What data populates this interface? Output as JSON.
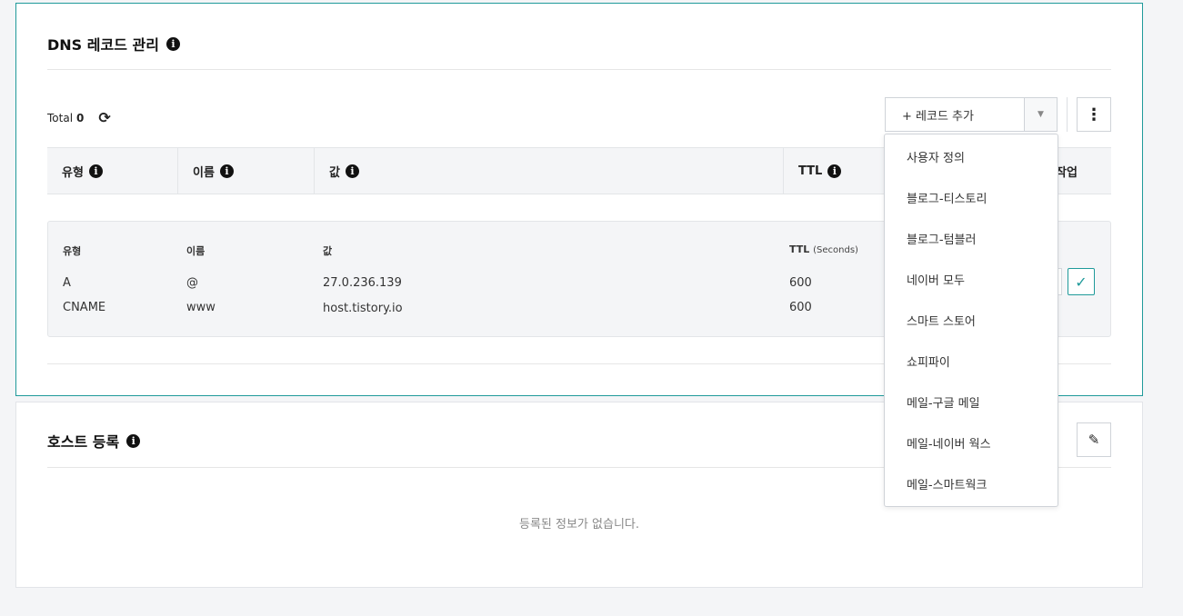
{
  "dns_section": {
    "title": "DNS 레코드 관리",
    "total_label": "Total",
    "total_count": "0",
    "add_record_label": "+ 레코드 추가",
    "table_headers": [
      "유형",
      "이름",
      "값",
      "TTL",
      "작업"
    ],
    "record_headers": {
      "type": "유형",
      "name": "이름",
      "value": "값",
      "ttl": "TTL",
      "ttl_unit": "(Seconds)"
    },
    "records": [
      {
        "type": "A",
        "name": "@",
        "value": "27.0.236.139",
        "ttl": "600"
      },
      {
        "type": "CNAME",
        "name": "www",
        "value": "host.tistory.io",
        "ttl": "600"
      }
    ]
  },
  "host_section": {
    "title": "호스트 등록",
    "empty_message": "등록된 정보가 없습니다."
  },
  "add_record_menu": [
    "사용자 정의",
    "블로그-티스토리",
    "블로그-텀블러",
    "네이버 모두",
    "스마트 스토어",
    "쇼피파이",
    "메일-구글 메일",
    "메일-네이버 웍스",
    "메일-스마트웍크"
  ],
  "colors": {
    "accent": "#1f9a9a",
    "background": "#f4f5f7",
    "text": "#222222",
    "muted": "#888888"
  },
  "icons": {
    "info": "info-icon",
    "refresh": "refresh-icon",
    "caret": "caret-down-icon",
    "more": "more-vertical-icon",
    "confirm": "check-icon",
    "edit": "pencil-icon"
  }
}
